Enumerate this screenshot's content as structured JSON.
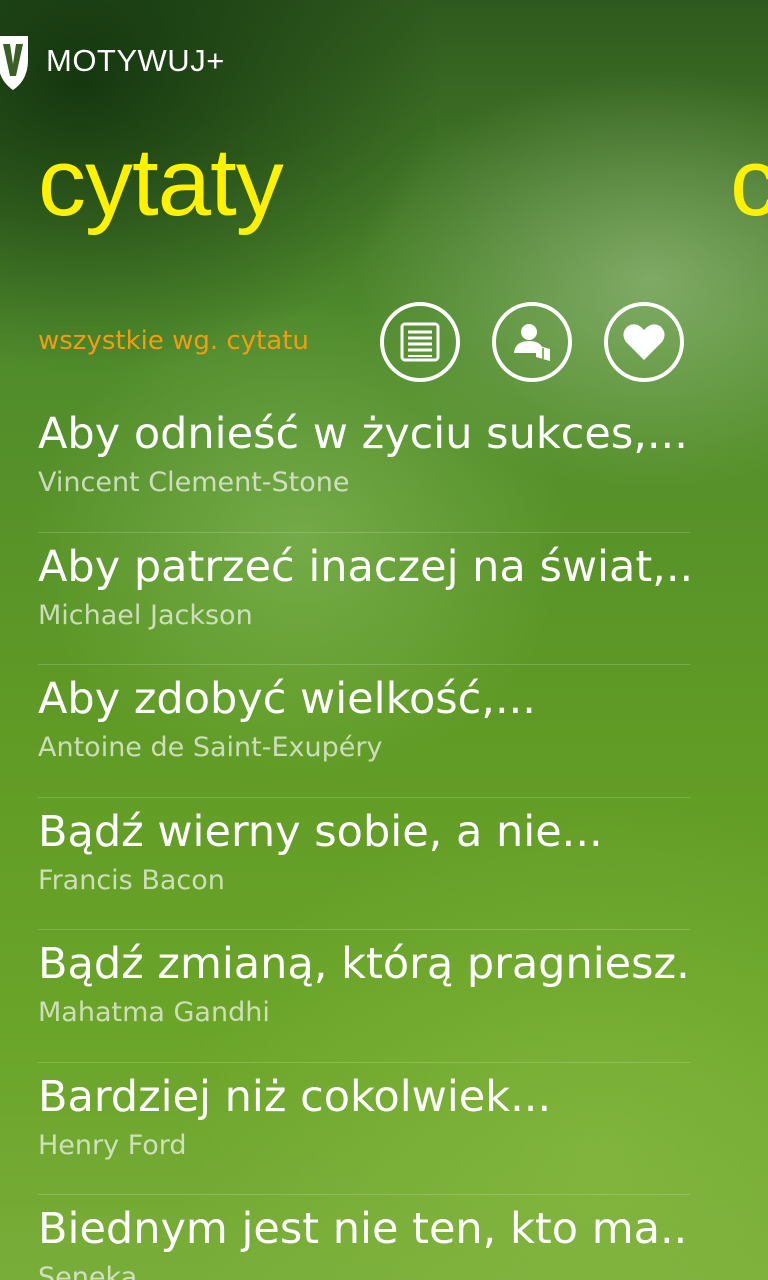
{
  "app": {
    "title": "MOTYWUJ+",
    "logo": "shield-v-logo"
  },
  "pivot": {
    "current": "cytaty",
    "next_peek": "c"
  },
  "filter": {
    "label": "wszystkie wg. cytatu"
  },
  "toolbar": [
    {
      "icon": "list-icon",
      "label": "sort by quote"
    },
    {
      "icon": "person-icon",
      "label": "sort by author"
    },
    {
      "icon": "heart-icon",
      "label": "favorites"
    }
  ],
  "colors": {
    "accent_title": "#fff200",
    "accent_filter": "#f39c12",
    "background": "#5f9a26"
  },
  "quotes": [
    {
      "text": "Aby odnieść w życiu sukces,...",
      "author": "Vincent Clement-Stone"
    },
    {
      "text": "Aby patrzeć inaczej na świat,...",
      "author": "Michael Jackson"
    },
    {
      "text": "Aby zdobyć wielkość,...",
      "author": "Antoine de Saint-Exupéry"
    },
    {
      "text": "Bądź wierny sobie, a nie...",
      "author": "Francis Bacon"
    },
    {
      "text": "Bądź zmianą, którą pragniesz...",
      "author": "Mahatma Gandhi"
    },
    {
      "text": "Bardziej niż cokolwiek...",
      "author": "Henry Ford"
    },
    {
      "text": "Biednym jest nie ten, kto ma...",
      "author": "Seneka"
    }
  ]
}
